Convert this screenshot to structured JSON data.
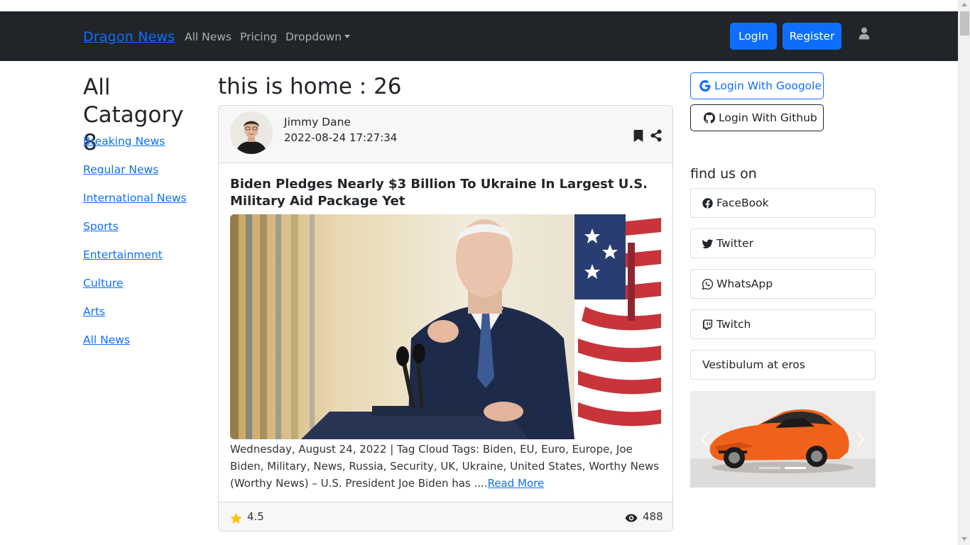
{
  "navbar": {
    "brand": "Dragon News",
    "links": [
      "All News",
      "Pricing",
      "Dropdown"
    ],
    "login_label": "LogIn",
    "register_label": "Register",
    "user_icon": "user-icon"
  },
  "left": {
    "title": "All Catagory 8",
    "categories": [
      "Breaking News",
      "Regular News",
      "International News",
      "Sports",
      "Entertainment",
      "Culture",
      "Arts",
      "All News"
    ]
  },
  "main": {
    "heading": "this is home : 26",
    "card": {
      "author_name": "Jimmy Dane",
      "published_date": "2022-08-24 17:27:34",
      "title": "Biden Pledges Nearly $3 Billion To Ukraine In Largest U.S. Military Aid Package Yet",
      "details": "Wednesday, August 24, 2022 | Tag Cloud Tags: Biden, EU, Euro, Europe, Joe Biden, Military, News, Russia, Security, UK, Ukraine, United States, Worthy News (Worthy News) – U.S. President Joe Biden has ....",
      "read_more": "Read More",
      "rating": "4.5",
      "views": "488"
    }
  },
  "right": {
    "google_login": "Login With Googole",
    "github_login": "Login With Github",
    "find_us_title": "find us on",
    "social": [
      "FaceBook",
      "Twitter",
      "WhatsApp",
      "Twitch",
      "Vestibulum at eros"
    ]
  },
  "colors": {
    "navbar_bg": "#212529",
    "primary": "#0d6efd",
    "star": "#ffc107"
  }
}
